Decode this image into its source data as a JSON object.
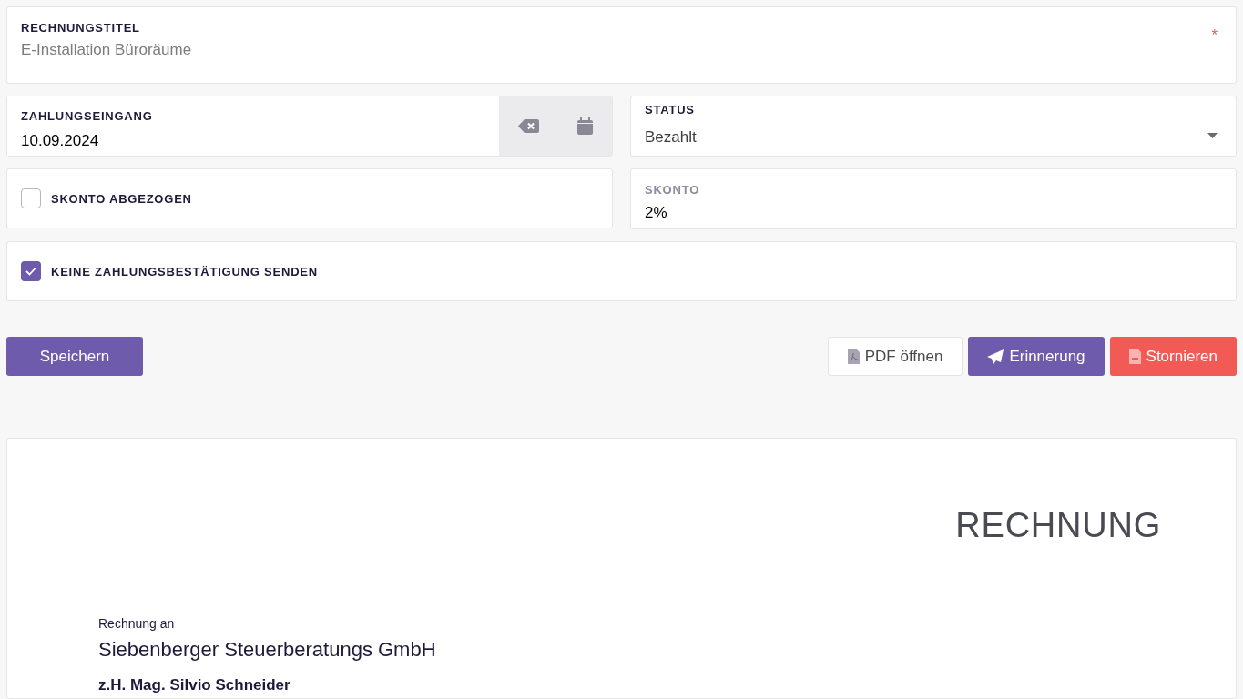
{
  "title_field": {
    "label": "RECHNUNGSTITEL",
    "placeholder": "E-Installation Büroräume",
    "required_mark": "*"
  },
  "payment_date": {
    "label": "ZAHLUNGSEINGANG",
    "value": "10.09.2024"
  },
  "status": {
    "label": "STATUS",
    "value": "Bezahlt"
  },
  "discount_checkbox": {
    "label": "SKONTO ABGEZOGEN",
    "checked": false
  },
  "discount": {
    "label": "SKONTO",
    "value": "2%"
  },
  "no_confirmation_checkbox": {
    "label": "KEINE ZAHLUNGSBESTÄTIGUNG SENDEN",
    "checked": true
  },
  "save_button": {
    "label": "Speichern"
  },
  "actions": [
    {
      "label": "PDF öffnen",
      "kind": "pdf"
    },
    {
      "label": "Erinnerung",
      "kind": "send"
    },
    {
      "label": "Stornieren",
      "kind": "cancel"
    }
  ],
  "document": {
    "heading": "RECHNUNG",
    "recipient_label": "Rechnung an",
    "company": "Siebenberger Steuerberatungs GmbH",
    "contact": "z.H. Mag. Silvio Schneider"
  }
}
